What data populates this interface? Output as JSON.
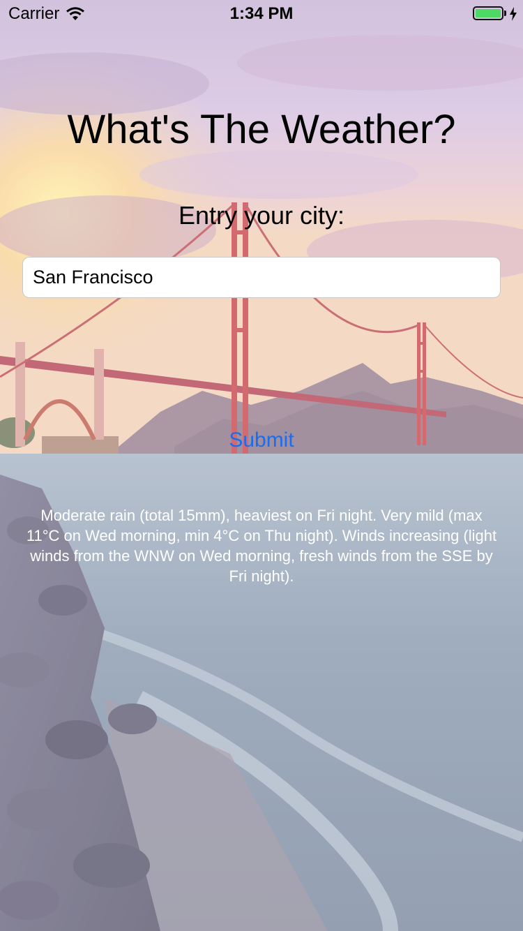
{
  "status_bar": {
    "carrier": "Carrier",
    "time": "1:34 PM",
    "battery_level": 1.0,
    "battery_color": "#4cd964"
  },
  "main": {
    "title": "What's The Weather?",
    "prompt": "Entry your city:",
    "city_input": {
      "value": "San Francisco",
      "placeholder": ""
    },
    "submit_label": "Submit",
    "forecast": "Moderate rain (total 15mm), heaviest on Fri night. Very mild (max 11°C on Wed morning, min 4°C on Thu night). Winds increasing (light winds from the WNW on Wed morning, fresh winds from the SSE by Fri night)."
  },
  "colors": {
    "accent": "#1a6cf0"
  },
  "icons": {
    "wifi": "wifi-icon",
    "battery": "battery-icon",
    "charging": "bolt-icon"
  }
}
